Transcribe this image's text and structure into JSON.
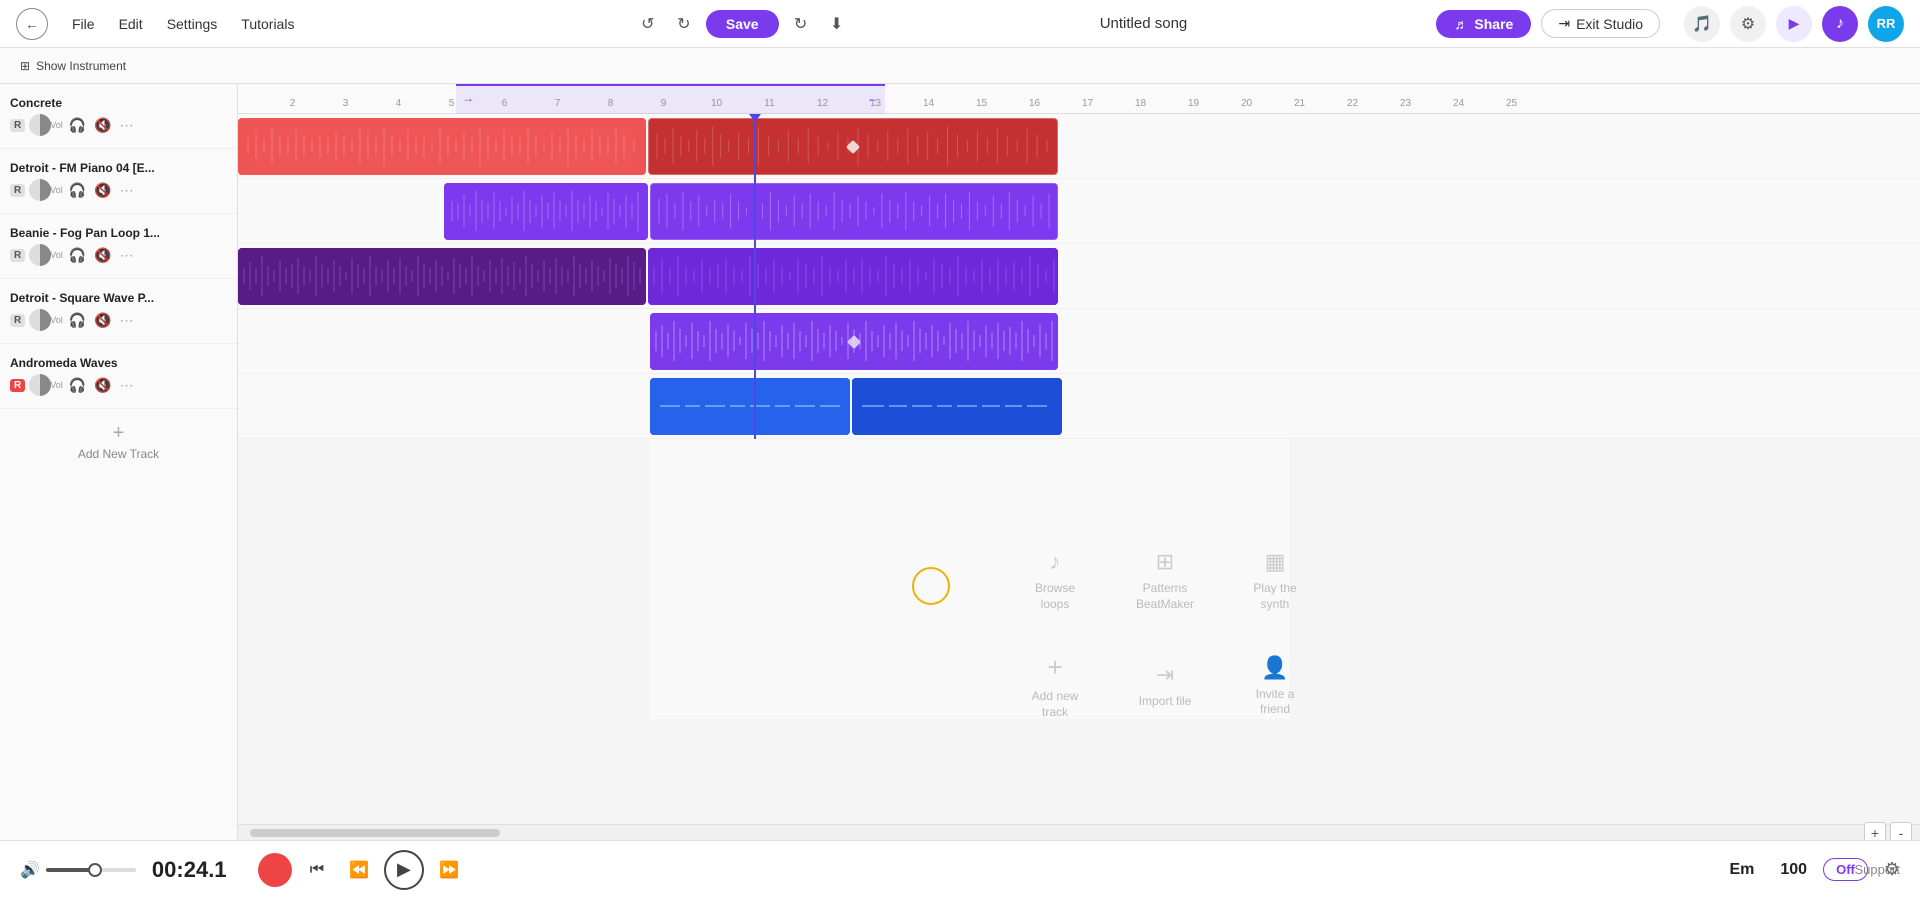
{
  "app": {
    "title": "Untitled song"
  },
  "nav": {
    "back_icon": "←",
    "menu_items": [
      "File",
      "Edit",
      "Settings",
      "Tutorials"
    ],
    "undo_icon": "↺",
    "redo_icon": "↻",
    "save_label": "Save",
    "share_label": "Share",
    "exit_label": "Exit Studio"
  },
  "toolbar": {
    "show_instrument_label": "Show Instrument"
  },
  "tracks": [
    {
      "name": "Concrete",
      "type": "audio",
      "r_badge": "R",
      "r_active": false,
      "color": "red"
    },
    {
      "name": "Detroit - FM Piano 04 [E...",
      "type": "instrument",
      "r_badge": "R",
      "r_active": false,
      "color": "purple_dark"
    },
    {
      "name": "Beanie - Fog Pan Loop 1...",
      "type": "audio",
      "r_badge": "R",
      "r_active": false,
      "color": "maroon"
    },
    {
      "name": "Detroit - Square Wave P...",
      "type": "audio",
      "r_badge": "R",
      "r_active": false,
      "color": "medium_purple"
    },
    {
      "name": "Andromeda Waves",
      "type": "synth",
      "r_badge": "R",
      "r_active": true,
      "color": "blue"
    }
  ],
  "add_track_label": "+ Add New Track",
  "ruler": {
    "marks": [
      "2",
      "3",
      "4",
      "5",
      "6",
      "7",
      "8",
      "9",
      "10",
      "11",
      "12",
      "13",
      "14",
      "15",
      "16",
      "17",
      "18",
      "19",
      "20",
      "21",
      "22",
      "23",
      "24",
      "25"
    ]
  },
  "transport": {
    "time": "00:24.1",
    "key": "Em",
    "bpm": "100",
    "off_label": "Off",
    "play_icon": "▶",
    "record_icon": "",
    "rewind_icon": "⏮",
    "back_icon": "⏪",
    "forward_icon": "⏩"
  },
  "actions": [
    {
      "icon": "♪",
      "label": "Browse loops"
    },
    {
      "icon": "⊞",
      "label": "Patterns BeatMaker"
    },
    {
      "icon": "▦",
      "label": "Play the synth"
    },
    {
      "icon": "+",
      "label": "Add new track"
    },
    {
      "icon": "⇥",
      "label": "Import file"
    },
    {
      "icon": "👤+",
      "label": "Invite a friend"
    }
  ],
  "support_label": "Support"
}
